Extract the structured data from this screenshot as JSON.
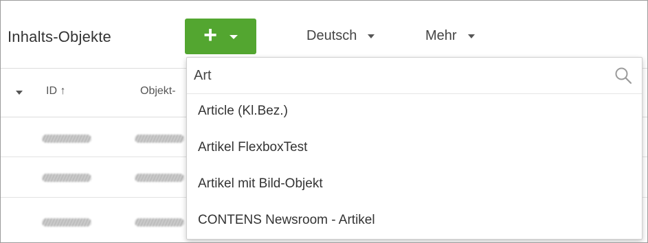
{
  "header": {
    "title": "Inhalts-Objekte",
    "add_button": {
      "icon": "plus-icon",
      "caret": "chevron-down-icon",
      "color": "#53a630"
    },
    "language_dropdown": "Deutsch",
    "more_dropdown": "Mehr"
  },
  "table": {
    "columns": [
      "ID ↑",
      "Objekt-"
    ]
  },
  "add_menu": {
    "search_value": "Art",
    "search_icon": "search-icon",
    "options": [
      "Article (Kl.Bez.)",
      "Artikel FlexboxTest",
      "Artikel mit Bild-Objekt",
      "CONTENS Newsroom - Artikel"
    ]
  }
}
